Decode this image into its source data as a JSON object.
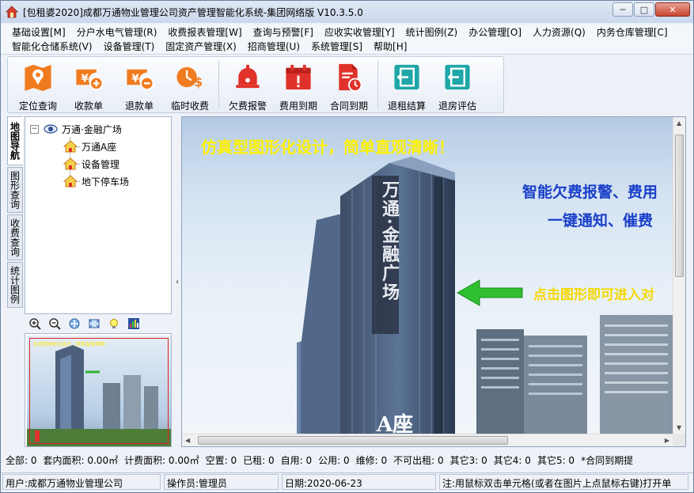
{
  "window": {
    "title": "[包租婆2020]成都万通物业管理公司资产管理智能化系统-集团网络版 V10.3.5.0",
    "controls": {
      "minimize": "─",
      "maximize": "□",
      "close": "✕"
    }
  },
  "menu": {
    "row1": [
      "基础设置[M]",
      "分户水电气管理(R)",
      "收费报表管理[W]",
      "查询与预警[F]",
      "应收实收管理[Y]",
      "统计图例(Z)",
      "办公管理[O]",
      "人力资源(Q)",
      "内务仓库管理[C]"
    ],
    "row2": [
      "智能化仓储系统(V)",
      "设备管理(T)",
      "固定资产管理(X)",
      "招商管理(U)",
      "系统管理[S]",
      "帮助[H]"
    ]
  },
  "toolbar": {
    "locate": "定位查询",
    "receipt": "收款单",
    "refund": "退款单",
    "temp_charge": "临时收费",
    "arrears_alarm": "欠费报警",
    "fee_due": "费用到期",
    "contract_due": "合同到期",
    "lease_settle": "退租结算",
    "checkout_eval": "退房评估"
  },
  "left_tabs": [
    "地图导航",
    "图形查询",
    "收费查询",
    "统计图例"
  ],
  "tree": {
    "root": "万通·金融广场",
    "children": [
      "万通A座",
      "设备管理",
      "地下停车场"
    ]
  },
  "canvas": {
    "headline": "仿真型图形化设计，简单直观清晰！",
    "feature1": "智能欠费报警、费用",
    "feature2": "一键通知、催费",
    "hint": "点击图形即可进入对",
    "building_sign": "万通·金融广场",
    "building_label": "A座"
  },
  "thumbnail": {
    "headline": "仿真型图形化设计，简单直观清晰！"
  },
  "infobar": {
    "items": [
      "全部: 0",
      "套内面积: 0.00㎡",
      "计费面积: 0.00㎡",
      "空置: 0",
      "已租: 0",
      "自用: 0",
      "公用: 0",
      "维修: 0",
      "不可出租: 0",
      "其它3: 0",
      "其它4: 0",
      "其它5: 0",
      "*合同到期提"
    ]
  },
  "status": {
    "user": "用户:成都万通物业管理公司",
    "operator": "操作员:管理员",
    "date": "日期:2020-06-23",
    "tip": "注:用鼠标双击单元格(或者在图片上点鼠标右键)打开单"
  },
  "colors": {
    "orange_icon": "#f07b1f",
    "red_icon": "#e0322b",
    "teal_icon": "#1fa7a8",
    "headline_yellow": "#fff200",
    "feature_blue": "#1a3fc8",
    "hint_yellow": "#f5d800"
  }
}
